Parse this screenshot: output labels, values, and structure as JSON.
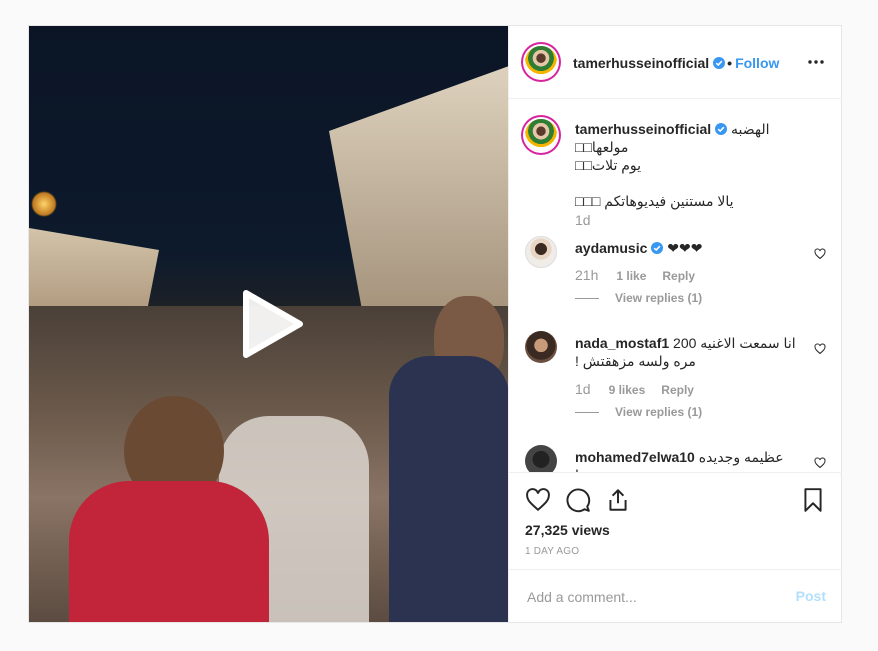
{
  "colors": {
    "accent": "#3897f0",
    "text": "#262626",
    "muted": "#999999",
    "verified": "#3897f0"
  },
  "icons": {
    "play": "play-icon",
    "more": "more-options-icon",
    "verified": "verified-badge-icon",
    "like": "heart-icon",
    "comment": "comment-icon",
    "share": "share-icon",
    "save": "bookmark-icon",
    "comment_like": "small-heart-icon"
  },
  "header": {
    "username": "tamerhusseinofficial",
    "separator": "•",
    "follow_label": "Follow"
  },
  "caption": {
    "username": "tamerhusseinofficial",
    "line1": "الهضبه مولعها□□",
    "line2": "يوم تلات□□",
    "line3": "يالا مستنين فيديوهاتكم □□□",
    "time": "1d"
  },
  "comments": [
    {
      "username": "aydamusic",
      "verified": true,
      "text": "❤❤❤",
      "time": "21h",
      "likes": "1 like",
      "reply": "Reply",
      "replies": "View replies (1)"
    },
    {
      "username": "nada_mostaf1",
      "verified": false,
      "text": "انا سمعت الاغنيه 200 مره ولسه مزهقتش !",
      "time": "1d",
      "likes": "9 likes",
      "reply": "Reply",
      "replies": "View replies (1)"
    },
    {
      "username": "mohamed7elwa10",
      "verified": false,
      "text": "عظيمه وجديده جدا"
    }
  ],
  "stats": {
    "views": "27,325 views",
    "date": "1 DAY AGO"
  },
  "add_comment": {
    "placeholder": "Add a comment...",
    "post_label": "Post"
  }
}
